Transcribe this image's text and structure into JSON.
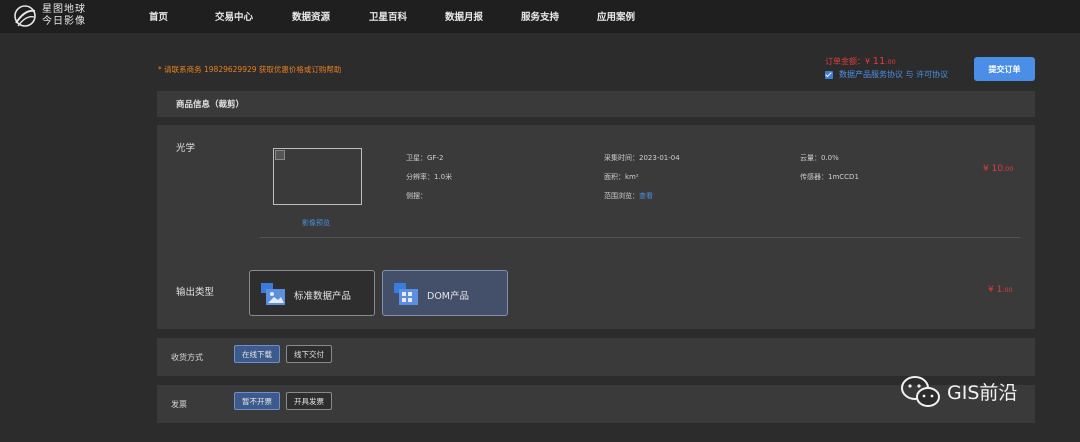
{
  "logo": {
    "line1": "星图地球",
    "line2": "今日影像"
  },
  "nav": [
    "首页",
    "交易中心",
    "数据资源",
    "卫星百科",
    "数据月报",
    "服务支持",
    "应用案例"
  ],
  "notice": "* 请联系商务 19829629929 获取优惠价格或订购帮助",
  "order": {
    "total_label": "订单金额：",
    "total_currency": "¥",
    "total_int": "11",
    "total_dec": ".00",
    "agree_text": "数据产品服务协议 与 许可协议",
    "submit_label": "提交订单"
  },
  "header": {
    "title": "商品信息（裁剪）"
  },
  "product": {
    "section_label": "光学",
    "preview_label": "影像预览",
    "satellite": "卫星：GF-2",
    "resolution": "分辨率：1.0米",
    "swing": "侧摆：",
    "collect_time": "采集时间：2023-01-04",
    "area": "面积：km²",
    "range_label": "范围浏览：",
    "range_link": "查看",
    "cloud": "云量：0.0%",
    "sensor": "传感器：1mCCD1",
    "price_currency": "¥",
    "price_int": "10",
    "price_dec": ".00"
  },
  "output": {
    "section_label": "输出类型",
    "options": [
      "标准数据产品",
      "DOM产品"
    ],
    "selected": "DOM产品",
    "price_currency": "¥",
    "price_int": "1",
    "price_dec": ".00"
  },
  "delivery": {
    "label": "收货方式",
    "options": [
      "在线下载",
      "线下交付"
    ],
    "selected": "在线下载"
  },
  "invoice": {
    "label": "发票",
    "options": [
      "暂不开票",
      "开具发票"
    ],
    "selected": "暂不开票"
  },
  "watermark": "GIS前沿",
  "colors": {
    "accent": "#4a8ee8",
    "price": "#e03c3c",
    "notice": "#e8811f",
    "panel": "#3a3a3a",
    "bg": "#2c2c2c"
  }
}
